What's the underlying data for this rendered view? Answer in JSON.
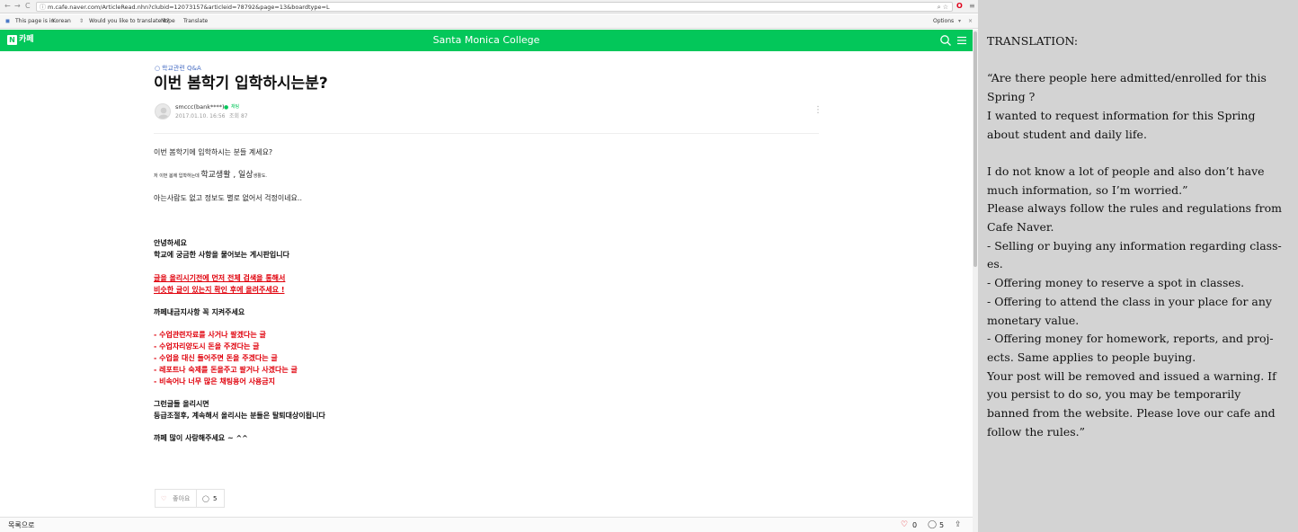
{
  "browser": {
    "back": "←",
    "forward": "→",
    "reload": "C",
    "url": "m.cafe.naver.com/ArticleRead.nhn?clubid=12073157&articleid=78792&page=13&boardtype=L",
    "omni_icons": "⌕ ☆",
    "opera_icon": "O",
    "menu_icon": "≡"
  },
  "translate_bar": {
    "page_is_in": "This page is in",
    "language": "Korean",
    "question": "Would you like to translate it?",
    "nope": "Nope",
    "translate": "Translate",
    "options": "Options",
    "close": "×"
  },
  "cafe": {
    "logo_letter": "N",
    "label": "카페",
    "title": "Santa Monica College"
  },
  "article": {
    "category": "학교관련 Q&A",
    "title": "이번 봄학기 입학하시는분?",
    "author": "smccc(bank****)",
    "badge": "채팅",
    "date": "2017.01.10. 16:56",
    "views": "조회 87",
    "more_icon": "⋮",
    "body": {
      "line1": "이번 봄학기에 입학하시는 분들 계세요?",
      "line2_small_a": "저 이번 봄에 입학하는데 ",
      "line2_mid": "학교생활 , 일상",
      "line2_small_b": "생활도.",
      "line3": "아는사람도 없고 정보도 별로 없어서 걱정이네요.."
    }
  },
  "notice": {
    "greeting": "안녕하세요",
    "intro": "학교에 궁금한 사항을 물어보는 게시판입니다",
    "search_first_1": "글을 올리시기전에 먼저 전체 검색을 통해서",
    "search_first_2": "비슷한 글이 있는지 확인 후에 올려주세요 !",
    "rules_title": "까페내금지사항 꼭 지켜주세요",
    "rules": [
      "- 수업관련자료를 사거나 팔겠다는 글",
      "- 수업자리양도시 돈을 주겠다는 글",
      "- 수업을 대신 들어주면 돈을 주겠다는 글",
      "- 레포트나 숙제를 돈을주고 팔거나 사겠다는 글",
      "- 비속어나 너무 많은 채팅용어 사용금지"
    ],
    "penalty_1": "그런글들 올리시면",
    "penalty_2": "등급조절후, 계속해서 올리시는 분들은 탈퇴대상이됩니다",
    "closing": "까페 많이 사랑해주세요 ~ ^^"
  },
  "actions": {
    "like_label": "좋아요",
    "comment_count": "5"
  },
  "footer": {
    "back_to_list": "목록으로",
    "likes": "0",
    "comments": "5"
  },
  "translation": {
    "heading": "TRANSLATION:",
    "quote_1": "“Are there people here admitted/enrolled for this Spring ?",
    "quote_2": "I wanted to request information for this Spring about student and daily life.",
    "quote_3": "I do not know a lot of people and also don’t have much information, so I’m worried.”",
    "rules_intro": "Please always follow the rules and regulations from Cafe Naver.",
    "rules": [
      "-      Selling or buying any information regarding class-es.",
      "-      Offering money to reserve a spot in classes.",
      "-      Offering to attend the class in your place for any monetary value.",
      "-      Offering money for homework, reports, and proj-ects. Same applies to people buying."
    ],
    "warning": "Your post will be removed and issued a warning. If you persist to do so, you may be temporarily banned from the website. Please love our cafe and follow the rules.”"
  },
  "colors": {
    "cafe_green": "#03c75a",
    "notice_red": "#e0000b",
    "panel_gray": "#d3d3d3",
    "category_blue": "#4a6fc4"
  }
}
